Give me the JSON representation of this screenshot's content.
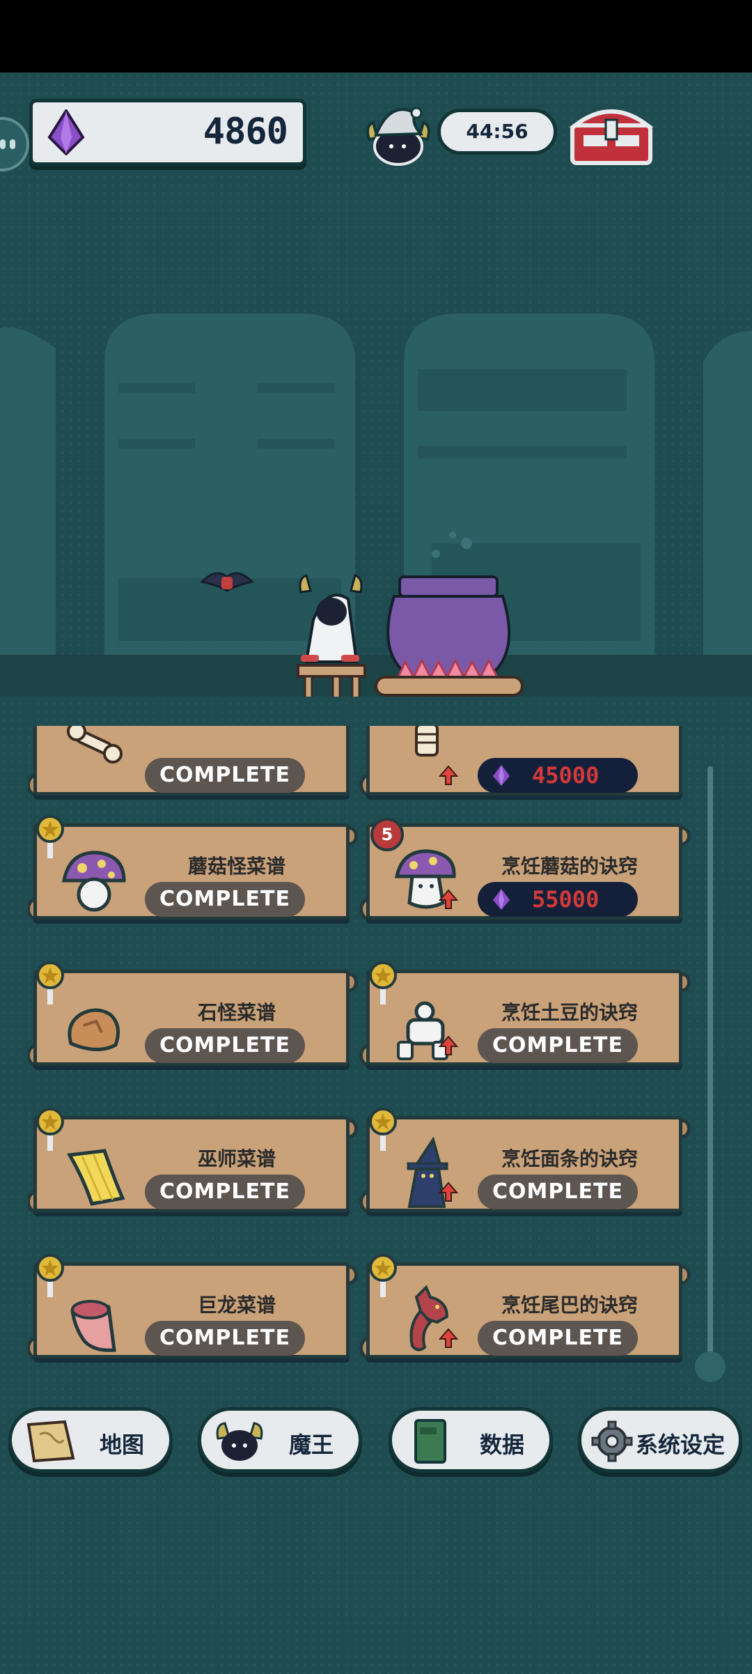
{
  "hud": {
    "gems": "4860",
    "timer": "44:56"
  },
  "quests": [
    {
      "title": "",
      "state": "COMPLETE",
      "icon": "bone-icon"
    },
    {
      "title": "",
      "price": "45000",
      "icon": "skeleton-icon"
    },
    {
      "title": "蘑菇怪菜谱",
      "state": "COMPLETE",
      "icon": "mushroom-icon"
    },
    {
      "title": "烹饪蘑菇的诀窍",
      "price": "55000",
      "badge": "5",
      "icon": "mushroom-monster-icon"
    },
    {
      "title": "石怪菜谱",
      "state": "COMPLETE",
      "icon": "rock-icon"
    },
    {
      "title": "烹饪土豆的诀窍",
      "state": "COMPLETE",
      "icon": "golem-icon"
    },
    {
      "title": "巫师菜谱",
      "state": "COMPLETE",
      "icon": "noodle-icon"
    },
    {
      "title": "烹饪面条的诀窍",
      "state": "COMPLETE",
      "icon": "wizard-icon"
    },
    {
      "title": "巨龙菜谱",
      "state": "COMPLETE",
      "icon": "meat-icon"
    },
    {
      "title": "烹饪尾巴的诀窍",
      "state": "COMPLETE",
      "icon": "dragon-icon"
    }
  ],
  "nav": {
    "map": "地图",
    "demon_king": "魔王",
    "data": "数据",
    "settings": "系统设定"
  },
  "colors": {
    "background": "#1f4c50",
    "scroll": "#c9a27a",
    "button": "#5d5550",
    "price_text": "#d23a3a"
  }
}
